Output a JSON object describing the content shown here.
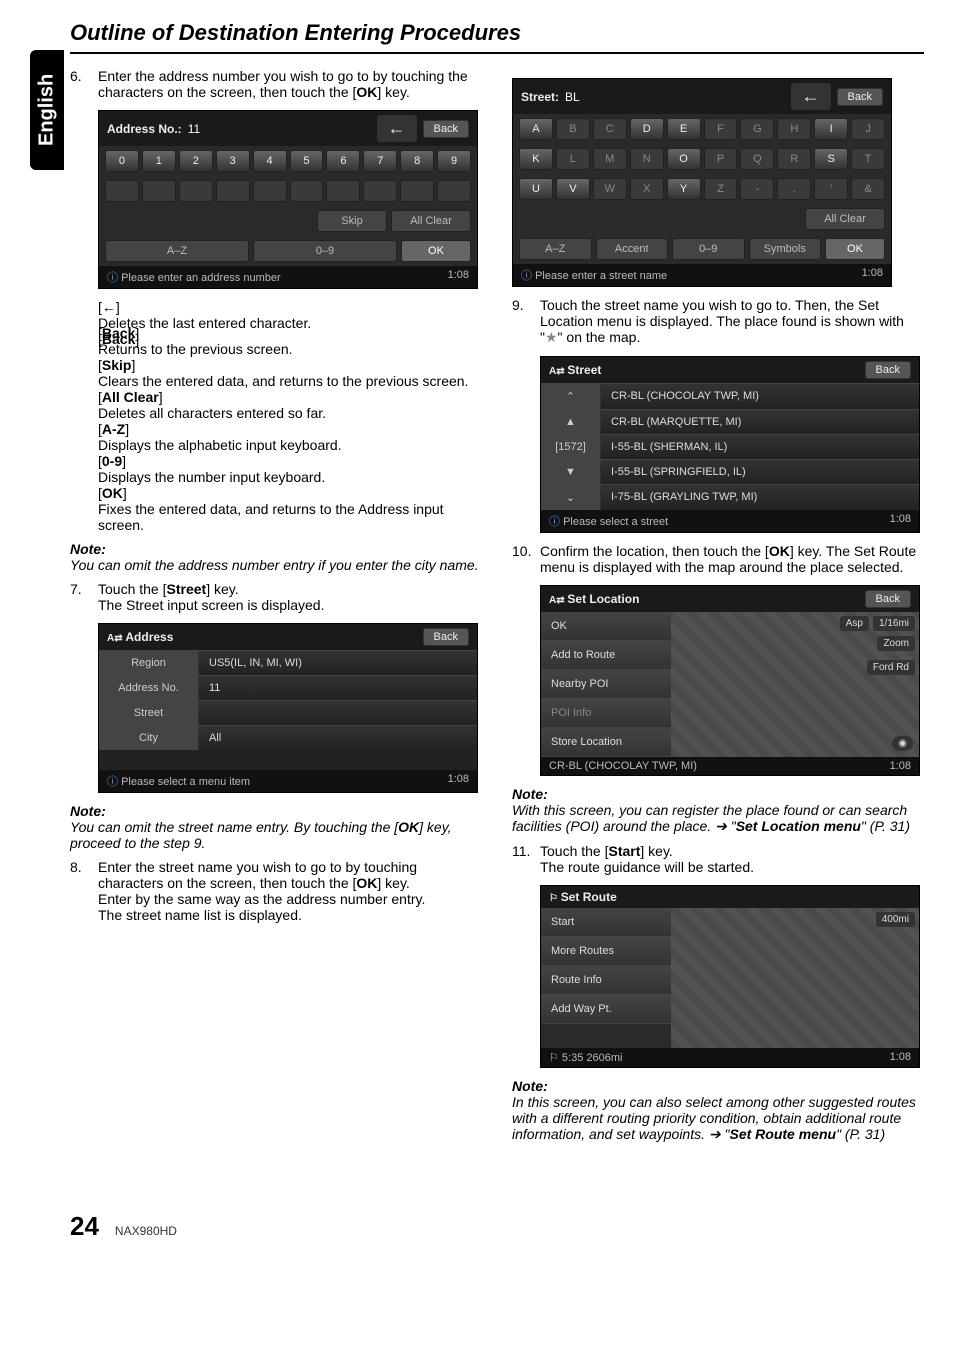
{
  "lang_tab": "English",
  "header_title": "Outline of Destination Entering Procedures",
  "left": {
    "step6": {
      "num": "6.",
      "text_a": "Enter the address number you wish to go to by touching the characters on the screen, then touch the [",
      "ok": "OK",
      "text_b": "] key."
    },
    "ss1": {
      "title": "Address No.:",
      "value": "11",
      "back_arrow": "←",
      "back": "Back",
      "keys": [
        "0",
        "1",
        "2",
        "3",
        "4",
        "5",
        "6",
        "7",
        "8",
        "9"
      ],
      "skip": "Skip",
      "allclear": "All Clear",
      "az": "A–Z",
      "num": "0–9",
      "ok": "OK",
      "status": "Please enter an address number",
      "time": "1:08"
    },
    "keys": {
      "back_arrow_label": "[←]",
      "back_arrow_desc": "Deletes the last entered character.",
      "back_label": "[Back]",
      "back_desc": "Returns to the previous screen.",
      "skip_label": "[Skip]",
      "skip_desc": "Clears the entered data, and returns to the previous screen.",
      "allclear_label": "[All Clear]",
      "allclear_desc": "Deletes all characters entered so far.",
      "az_label": "[A-Z]",
      "az_desc": "Displays the alphabetic input keyboard.",
      "num_label": "[0-9]",
      "num_desc": "Displays the number input keyboard.",
      "ok_label": "[OK]",
      "ok_desc": "Fixes the entered data, and returns to the Address input screen."
    },
    "note1": {
      "head": "Note:",
      "body": "You can omit the address number entry if you enter the city name."
    },
    "step7": {
      "num": "7.",
      "text_a": "Touch the [",
      "street": "Street",
      "text_b": "] key.",
      "line2": "The Street input screen is displayed."
    },
    "ss2": {
      "title": "Address",
      "back": "Back",
      "rows": [
        {
          "l": "Region",
          "r": "US5(IL, IN, MI, WI)"
        },
        {
          "l": "Address No.",
          "r": "11"
        },
        {
          "l": "Street",
          "r": ""
        },
        {
          "l": "City",
          "r": "All"
        }
      ],
      "status": "Please select a menu item",
      "time": "1:08"
    },
    "note2": {
      "head": "Note:",
      "body_a": "You can omit the street name entry. By touching the [",
      "ok": "OK",
      "body_b": "] key, proceed to the step 9."
    },
    "step8": {
      "num": "8.",
      "line1_a": "Enter the street name you wish to go to by touching characters on the screen, then touch the [",
      "ok": "OK",
      "line1_b": "] key.",
      "line2": "Enter by the same way as the address number entry.",
      "line3": "The street name list is displayed."
    }
  },
  "right": {
    "ss3": {
      "title": "Street:",
      "value": "BL",
      "back_arrow": "←",
      "back": "Back",
      "row1": [
        "A",
        "B",
        "C",
        "D",
        "E",
        "F",
        "G",
        "H",
        "I",
        "J"
      ],
      "row2": [
        "K",
        "L",
        "M",
        "N",
        "O",
        "P",
        "Q",
        "R",
        "S",
        "T"
      ],
      "row3": [
        "U",
        "V",
        "W",
        "X",
        "Y",
        "Z",
        "-",
        ".",
        "'",
        "&"
      ],
      "allclear": "All Clear",
      "az": "A–Z",
      "accent": "Accent",
      "num": "0–9",
      "symbols": "Symbols",
      "ok": "OK",
      "status": "Please enter a street name",
      "time": "1:08"
    },
    "step9": {
      "num": "9.",
      "line1": "Touch the street name you wish to go to. Then, the Set Location menu is displayed. The place found is shown with \"",
      "star": "★",
      "line1b": "\" on the map."
    },
    "ss4": {
      "title": "Street",
      "back": "Back",
      "rows_left": [
        "⌃",
        "▲",
        "[1572]",
        "▼",
        "⌄"
      ],
      "rows_right": [
        "CR-BL (CHOCOLAY TWP, MI)",
        "CR-BL (MARQUETTE, MI)",
        "I-55-BL (SHERMAN, IL)",
        "I-55-BL (SPRINGFIELD, IL)",
        "I-75-BL (GRAYLING TWP, MI)"
      ],
      "status": "Please select a street",
      "time": "1:08"
    },
    "step10": {
      "num": "10.",
      "line1_a": "Confirm the location, then touch the [",
      "ok": "OK",
      "line1_b": "] key. The Set Route menu is displayed with the map around the place selected."
    },
    "ss5": {
      "title": "Set Location",
      "back": "Back",
      "items": [
        "OK",
        "Add to Route",
        "Nearby POI",
        "POI Info",
        "Store Location"
      ],
      "chip1": "1/16mi",
      "chip2": "Zoom",
      "chip3": "Ford Rd",
      "chip4": "Asp",
      "status": "CR-BL (CHOCOLAY TWP, MI)",
      "time": "1:08"
    },
    "note3": {
      "head": "Note:",
      "body_a": "With this screen, you can register the place found or can search facilities (POI) around the place. ➔ \"",
      "ref": "Set Location menu",
      "body_b": "\" (P. 31)"
    },
    "step11": {
      "num": "11.",
      "line1_a": "Touch the [",
      "start": "Start",
      "line1_b": "] key.",
      "line2": "The route guidance will be started."
    },
    "ss6": {
      "title": "Set Route",
      "items": [
        "Start",
        "More Routes",
        "Route Info",
        "Add Way Pt."
      ],
      "chip1": "400mi",
      "status_left": "5:35 2606mi",
      "time": "1:08"
    },
    "note4": {
      "head": "Note:",
      "body_a": "In this screen, you can also select among other suggested routes with a different routing priority condition, obtain additional route information, and set waypoints. ➔ \"",
      "ref": "Set Route menu",
      "body_b": "\" (P. 31)"
    }
  },
  "footer": {
    "page": "24",
    "model": "NAX980HD"
  }
}
